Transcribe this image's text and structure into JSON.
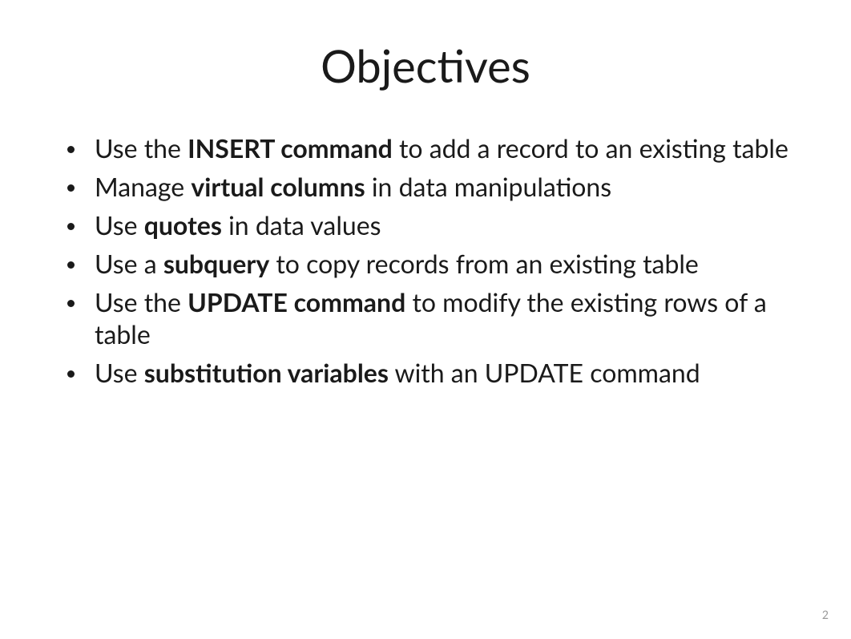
{
  "title": "Objectives",
  "bullets": [
    {
      "pre": "Use the ",
      "bold": "INSERT command",
      "post": " to add a record to an existing table"
    },
    {
      "pre": "Manage ",
      "bold": "virtual columns",
      "post": " in data manipulations"
    },
    {
      "pre": "Use ",
      "bold": "quotes",
      "post": " in data values"
    },
    {
      "pre": "Use a ",
      "bold": "subquery",
      "post": " to copy records from an existing table"
    },
    {
      "pre": "Use the ",
      "bold": "UPDATE command",
      "post": " to modify the existing rows of a table"
    },
    {
      "pre": "Use ",
      "bold": "substitution variables",
      "post": " with an UPDATE command"
    }
  ],
  "page_number": "2"
}
